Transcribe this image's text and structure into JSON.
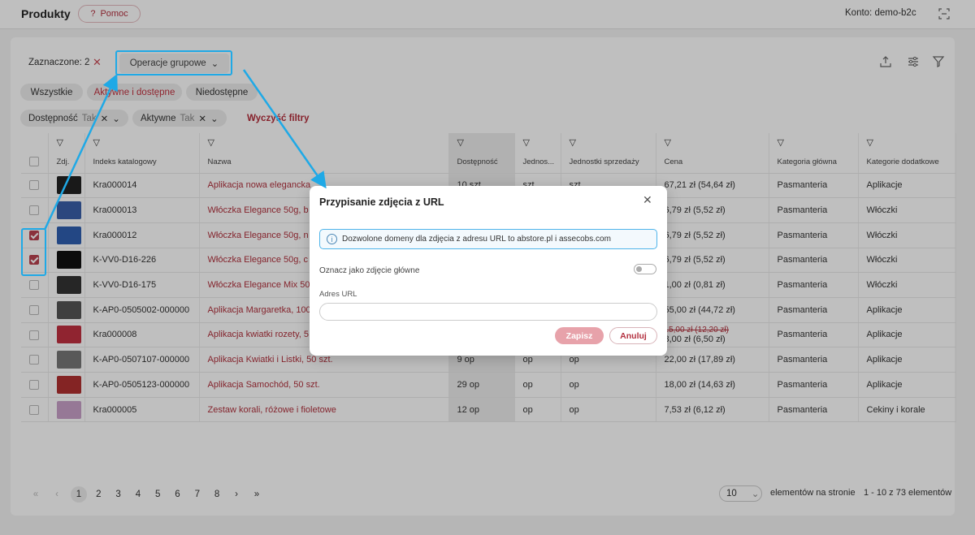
{
  "header": {
    "title": "Produkty",
    "help_label": "Pomoc",
    "help_icon": "?",
    "account": "Konto: demo-b2c"
  },
  "toolbar": {
    "selected_label": "Zaznaczone: 2",
    "bulk_label": "Operacje grupowe"
  },
  "tabs": [
    "Wszystkie",
    "Aktywne i dostępne",
    "Niedostępne"
  ],
  "filters": {
    "chips": [
      {
        "label": "Dostępność",
        "value": "Tak"
      },
      {
        "label": "Aktywne",
        "value": "Tak"
      }
    ],
    "clear_label": "Wyczyść filtry"
  },
  "table": {
    "columns": [
      "Zdj.",
      "Indeks katalogowy",
      "Nazwa",
      "Dostępność",
      "Jednos...",
      "Jednostki sprzedaży",
      "Cena",
      "Kategoria główna",
      "Kategorie dodatkowe"
    ],
    "rows": [
      {
        "checked": false,
        "sku": "Kra000014",
        "name": "Aplikacja nowa elegancka",
        "avail": "10 szt.",
        "unit": "szt.",
        "sale_unit": "szt.",
        "price": "67,21 zł (54,64 zł)",
        "cat": "Pasmanteria",
        "extra": "Aplikacje"
      },
      {
        "checked": false,
        "sku": "Kra000013",
        "name": "Włóczka Elegance 50g, b",
        "avail": "",
        "unit": "",
        "sale_unit": "",
        "price": "6,79 zł (5,52 zł)",
        "cat": "Pasmanteria",
        "extra": "Włóczki"
      },
      {
        "checked": true,
        "sku": "Kra000012",
        "name": "Włóczka Elegance 50g, n",
        "avail": "",
        "unit": "",
        "sale_unit": "",
        "price": "6,79 zł (5,52 zł)",
        "cat": "Pasmanteria",
        "extra": "Włóczki"
      },
      {
        "checked": true,
        "sku": "K-VV0-D16-226",
        "name": "Włóczka Elegance 50g, c",
        "avail": "",
        "unit": "",
        "sale_unit": "",
        "price": "6,79 zł (5,52 zł)",
        "cat": "Pasmanteria",
        "extra": "Włóczki"
      },
      {
        "checked": false,
        "sku": "K-VV0-D16-175",
        "name": "Włóczka Elegance Mix 50",
        "avail": "",
        "unit": "",
        "sale_unit": "",
        "price": "1,00 zł (0,81 zł)",
        "cat": "Pasmanteria",
        "extra": "Włóczki"
      },
      {
        "checked": false,
        "sku": "K-AP0-0505002-000000",
        "name": "Aplikacja Margaretka, 100",
        "avail": "",
        "unit": "",
        "sale_unit": "",
        "price": "55,00 zł (44,72 zł)",
        "cat": "Pasmanteria",
        "extra": "Aplikacje"
      },
      {
        "checked": false,
        "sku": "Kra000008",
        "name": "Aplikacja kwiatki rozety, 5",
        "avail": "",
        "unit": "",
        "sale_unit": "",
        "price": "8,00 zł (6,50 zł)",
        "old_price": "15,00 zł (12,20 zł)",
        "cat": "Pasmanteria",
        "extra": "Aplikacje"
      },
      {
        "checked": false,
        "sku": "K-AP0-0507107-000000",
        "name": "Aplikacja Kwiatki i Listki, 50 szt.",
        "avail": "9 op",
        "unit": "op",
        "sale_unit": "op",
        "price": "22,00 zł (17,89 zł)",
        "cat": "Pasmanteria",
        "extra": "Aplikacje"
      },
      {
        "checked": false,
        "sku": "K-AP0-0505123-000000",
        "name": "Aplikacja Samochód, 50 szt.",
        "avail": "29 op",
        "unit": "op",
        "sale_unit": "op",
        "price": "18,00 zł (14,63 zł)",
        "cat": "Pasmanteria",
        "extra": "Aplikacje"
      },
      {
        "checked": false,
        "sku": "Kra000005",
        "name": "Zestaw korali, różowe i fioletowe",
        "avail": "12 op",
        "unit": "op",
        "sale_unit": "op",
        "price": "7,53 zł (6,12 zł)",
        "cat": "Pasmanteria",
        "extra": "Cekiny i korale"
      }
    ]
  },
  "pagination": {
    "pages": [
      "1",
      "2",
      "3",
      "4",
      "5",
      "6",
      "7",
      "8"
    ],
    "current": "1",
    "per_page": "10",
    "per_page_label": "elementów na stronie",
    "range": "1 - 10 z 73 elementów"
  },
  "modal": {
    "title": "Przypisanie zdjęcia z URL",
    "info": "Dozwolone domeny dla zdjęcia z adresu URL to abstore.pl i assecobs.com",
    "main_photo_label": "Oznacz jako zdjęcie główne",
    "main_photo_on": false,
    "url_label": "Adres URL",
    "url_value": "",
    "save_label": "Zapisz",
    "cancel_label": "Anuluj"
  },
  "colors": {
    "accent": "#b3303f",
    "highlight": "#1fa9e6"
  }
}
